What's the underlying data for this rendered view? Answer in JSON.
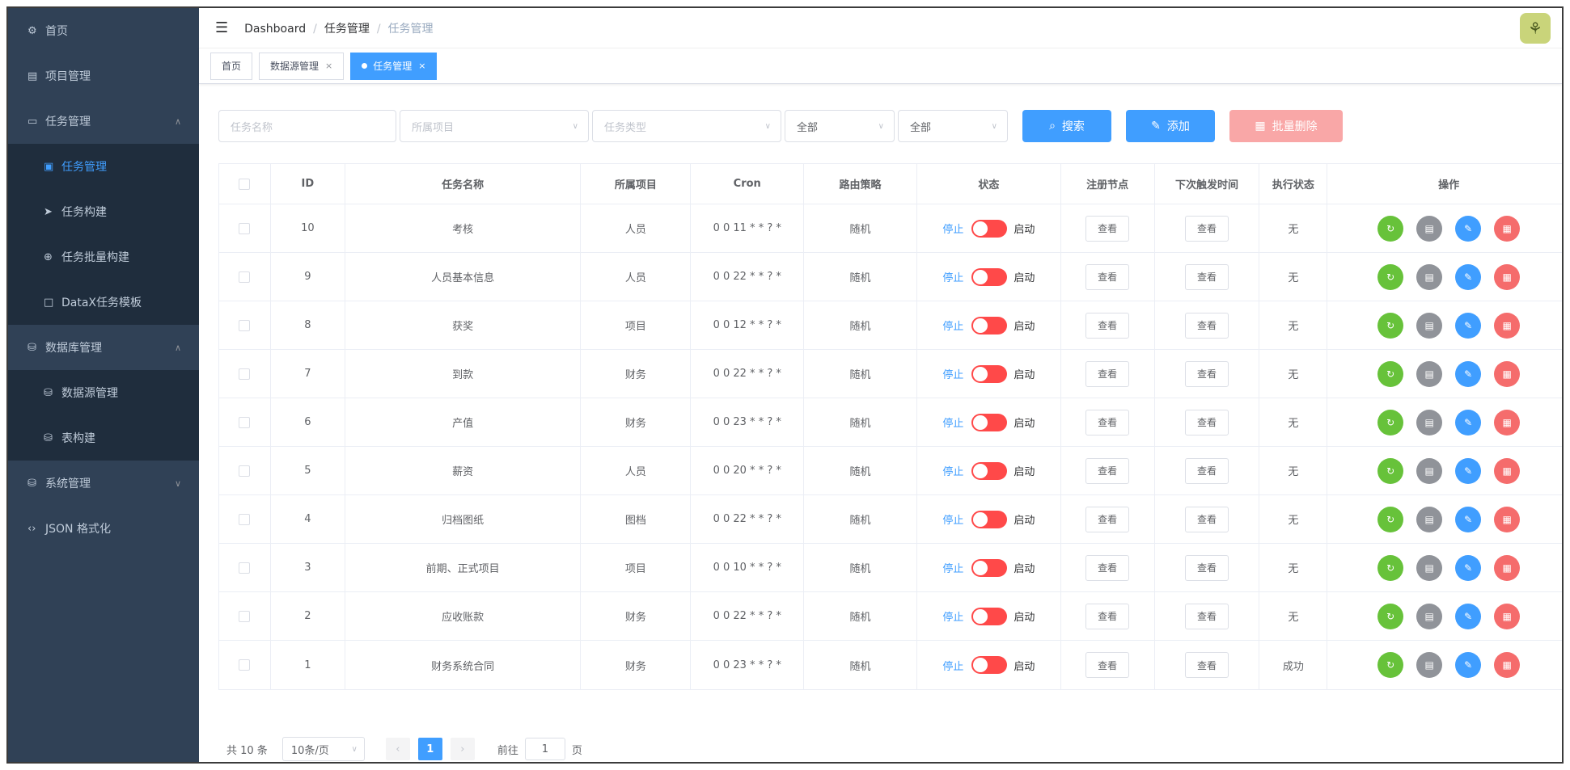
{
  "sidebar": {
    "items": [
      {
        "icon": "dashboard-icon",
        "label": "首页"
      },
      {
        "icon": "project-icon",
        "label": "项目管理"
      },
      {
        "icon": "monitor-icon",
        "label": "任务管理"
      },
      {
        "icon": "task-icon",
        "label": "任务管理"
      },
      {
        "icon": "send-icon",
        "label": "任务构建"
      },
      {
        "icon": "batch-icon",
        "label": "任务批量构建"
      },
      {
        "icon": "template-icon",
        "label": "DataX任务模板"
      },
      {
        "icon": "database-icon",
        "label": "数据库管理"
      },
      {
        "icon": "datasource-icon",
        "label": "数据源管理"
      },
      {
        "icon": "table-icon",
        "label": "表构建"
      },
      {
        "icon": "system-icon",
        "label": "系统管理"
      },
      {
        "icon": "json-icon",
        "label": "JSON 格式化"
      }
    ]
  },
  "header": {
    "breadcrumb": [
      "Dashboard",
      "任务管理",
      "任务管理"
    ]
  },
  "tabs": [
    {
      "label": "首页",
      "closable": false,
      "active": false
    },
    {
      "label": "数据源管理",
      "closable": true,
      "active": false
    },
    {
      "label": "任务管理",
      "closable": true,
      "active": true
    }
  ],
  "filters": {
    "name_placeholder": "任务名称",
    "project_placeholder": "所属项目",
    "type_placeholder": "任务类型",
    "select1_value": "全部",
    "select2_value": "全部",
    "search_label": "搜索",
    "add_label": "添加",
    "batch_delete_label": "批量删除"
  },
  "table": {
    "headers": [
      "",
      "ID",
      "任务名称",
      "所属项目",
      "Cron",
      "路由策略",
      "状态",
      "注册节点",
      "下次触发时间",
      "执行状态",
      "操作"
    ],
    "stop_label": "停止",
    "start_label": "启动",
    "view_label": "查看",
    "rows": [
      {
        "id": "10",
        "name": "考核",
        "project": "人员",
        "cron": "0 0 11 * * ? *",
        "route": "随机",
        "exec": "无"
      },
      {
        "id": "9",
        "name": "人员基本信息",
        "project": "人员",
        "cron": "0 0 22 * * ? *",
        "route": "随机",
        "exec": "无"
      },
      {
        "id": "8",
        "name": "获奖",
        "project": "项目",
        "cron": "0 0 12 * * ? *",
        "route": "随机",
        "exec": "无"
      },
      {
        "id": "7",
        "name": "到款",
        "project": "财务",
        "cron": "0 0 22 * * ? *",
        "route": "随机",
        "exec": "无"
      },
      {
        "id": "6",
        "name": "产值",
        "project": "财务",
        "cron": "0 0 23 * * ? *",
        "route": "随机",
        "exec": "无"
      },
      {
        "id": "5",
        "name": "薪资",
        "project": "人员",
        "cron": "0 0 20 * * ? *",
        "route": "随机",
        "exec": "无"
      },
      {
        "id": "4",
        "name": "归档图纸",
        "project": "图档",
        "cron": "0 0 22 * * ? *",
        "route": "随机",
        "exec": "无"
      },
      {
        "id": "3",
        "name": "前期、正式项目",
        "project": "项目",
        "cron": "0 0 10 * * ? *",
        "route": "随机",
        "exec": "无"
      },
      {
        "id": "2",
        "name": "应收账款",
        "project": "财务",
        "cron": "0 0 22 * * ? *",
        "route": "随机",
        "exec": "无"
      },
      {
        "id": "1",
        "name": "财务系统合同",
        "project": "财务",
        "cron": "0 0 23 * * ? *",
        "route": "随机",
        "exec": "成功"
      }
    ]
  },
  "pagination": {
    "total": "共 10 条",
    "page_size": "10条/页",
    "current": "1",
    "goto_label": "前往",
    "goto_value": "1",
    "page_unit": "页"
  }
}
